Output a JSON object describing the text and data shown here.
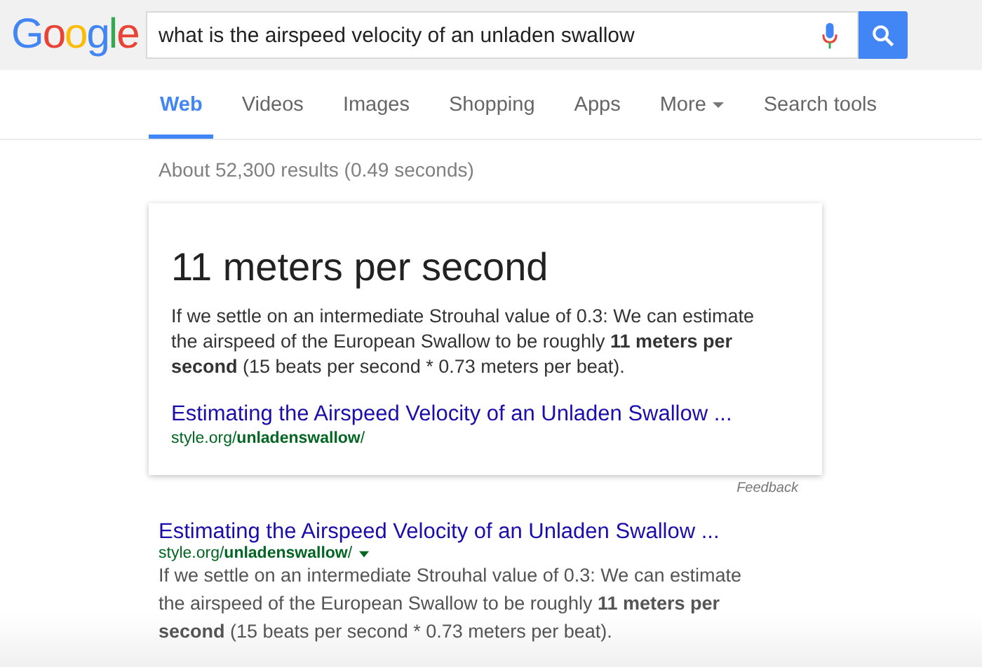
{
  "logo": "Google",
  "search": {
    "value": "what is the airspeed velocity of an unladen swallow"
  },
  "tabs": [
    {
      "label": "Web",
      "selected": true,
      "dropdown": false
    },
    {
      "label": "Videos",
      "selected": false,
      "dropdown": false
    },
    {
      "label": "Images",
      "selected": false,
      "dropdown": false
    },
    {
      "label": "Shopping",
      "selected": false,
      "dropdown": false
    },
    {
      "label": "Apps",
      "selected": false,
      "dropdown": false
    },
    {
      "label": "More",
      "selected": false,
      "dropdown": true
    },
    {
      "label": "Search tools",
      "selected": false,
      "dropdown": false
    }
  ],
  "result_stats": "About 52,300 results (0.49 seconds)",
  "answer_card": {
    "answer": "11 meters per second",
    "snippet": "If we settle on an intermediate Strouhal value of 0.3: We can estimate the airspeed of the European Swallow to be roughly **11 meters per second** (15 beats per second * 0.73 meters per beat).",
    "link": "Estimating the Airspeed Velocity of an Unladen Swallow ...",
    "url": "style.org/**unladenswallow**/"
  },
  "feedback": "Feedback",
  "results": [
    {
      "title": "Estimating the Airspeed Velocity of an Unladen Swallow ...",
      "url": "style.org/**unladenswallow**/",
      "snippet": "If we settle on an intermediate Strouhal value of 0.3: We can estimate the airspeed of the European Swallow to be roughly **11 meters per second** (15 beats per second * 0.73 meters per beat)."
    }
  ]
}
